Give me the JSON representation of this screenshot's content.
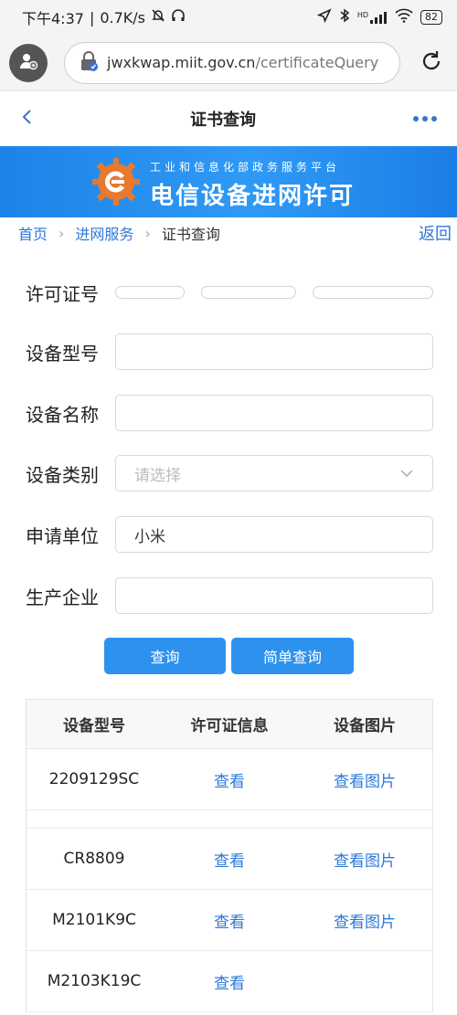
{
  "status": {
    "time": "下午4:37",
    "speed": "0.7K/s",
    "battery": "82",
    "hd_label": "HD"
  },
  "browser": {
    "url_host": "jwxkwap.miit.gov.cn",
    "url_path": "/certificateQuery"
  },
  "nav": {
    "title": "证书查询"
  },
  "banner": {
    "subtitle": "工业和信息化部政务服务平台",
    "title": "电信设备进网许可"
  },
  "breadcrumb": {
    "items": [
      "首页",
      "进网服务",
      "证书查询"
    ],
    "back": "返回"
  },
  "form": {
    "license_label": "许可证号",
    "model_label": "设备型号",
    "model_value": "",
    "name_label": "设备名称",
    "name_value": "",
    "category_label": "设备类别",
    "category_placeholder": "请选择",
    "applicant_label": "申请单位",
    "applicant_value": "小米",
    "manufacturer_label": "生产企业",
    "manufacturer_value": ""
  },
  "buttons": {
    "query": "查询",
    "simple_query": "简单查询"
  },
  "table": {
    "headers": [
      "设备型号",
      "许可证信息",
      "设备图片"
    ],
    "rows": [
      {
        "model": "2209129SC",
        "license": "查看",
        "image": "查看图片"
      },
      {
        "model": "CR8809",
        "license": "查看",
        "image": "查看图片"
      },
      {
        "model": "M2101K9C",
        "license": "查看",
        "image": "查看图片"
      },
      {
        "model": "M2103K19C",
        "license": "查看",
        "image": ""
      }
    ]
  },
  "colors": {
    "accent": "#2d92ee",
    "link": "#2d78d8",
    "banner": "#1e83e8"
  }
}
